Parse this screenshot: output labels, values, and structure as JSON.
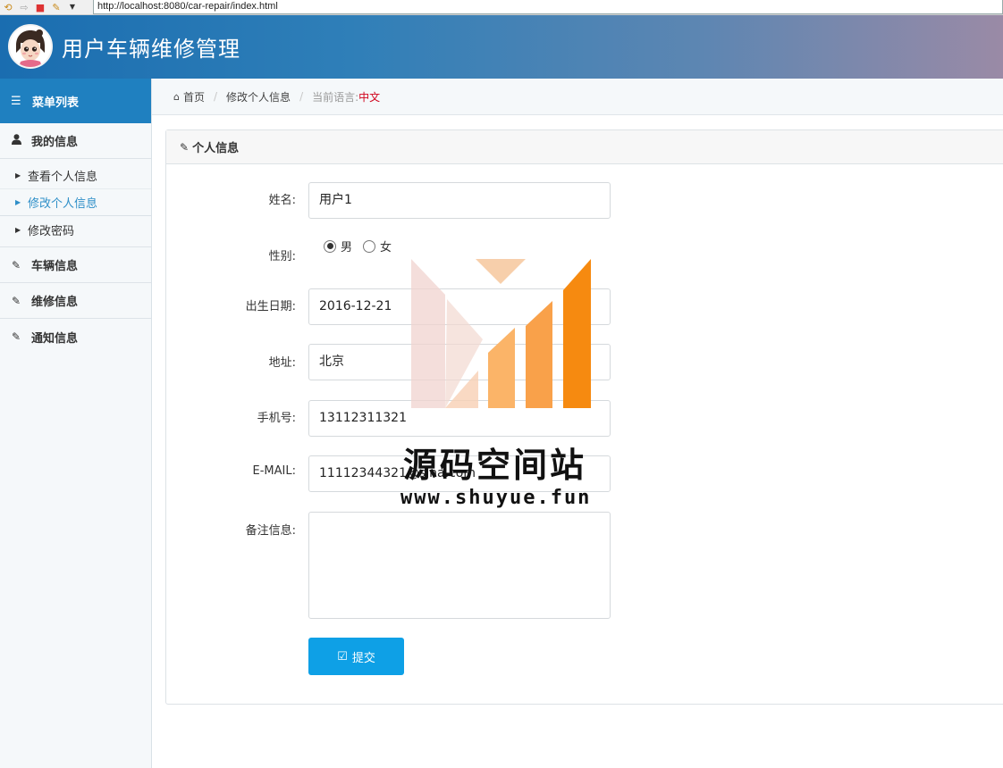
{
  "browser": {
    "url": "http://localhost:8080/car-repair/index.html"
  },
  "header": {
    "title": "用户车辆维修管理"
  },
  "sidebar": {
    "menu_title": "菜单列表",
    "groups": [
      {
        "label": "我的信息",
        "icon": "user-icon"
      },
      {
        "label": "车辆信息",
        "icon": "edit-icon"
      },
      {
        "label": "维修信息",
        "icon": "edit-icon"
      },
      {
        "label": "通知信息",
        "icon": "edit-icon"
      }
    ],
    "sub_items": [
      {
        "label": "查看个人信息",
        "active": false
      },
      {
        "label": "修改个人信息",
        "active": true
      },
      {
        "label": "修改密码",
        "active": false
      }
    ]
  },
  "breadcrumb": {
    "home": "首页",
    "current": "修改个人信息",
    "lang_label": "当前语言:",
    "lang_value": "中文"
  },
  "panel": {
    "title": "个人信息"
  },
  "form": {
    "name_label": "姓名:",
    "name_value": "用户1",
    "gender_label": "性别:",
    "gender_options": [
      "男",
      "女"
    ],
    "gender_selected": "男",
    "birth_label": "出生日期:",
    "birth_value": "2016-12-21",
    "address_label": "地址:",
    "address_value": "北京",
    "phone_label": "手机号:",
    "phone_value": "13112311321",
    "email_label": "E-MAIL:",
    "email_value": "11112344321@sina.com",
    "remark_label": "备注信息:",
    "remark_value": "",
    "submit_label": "提交"
  },
  "watermark": {
    "text": "源码空间站",
    "url": "www.shuyue.fun"
  },
  "colors": {
    "header_start": "#1a6db0",
    "header_end": "#9a8aa6",
    "menu_head": "#1f80c0",
    "active_link": "#2f8fc8",
    "lang_value": "#d0021b",
    "submit_button": "#0ea0e6"
  }
}
